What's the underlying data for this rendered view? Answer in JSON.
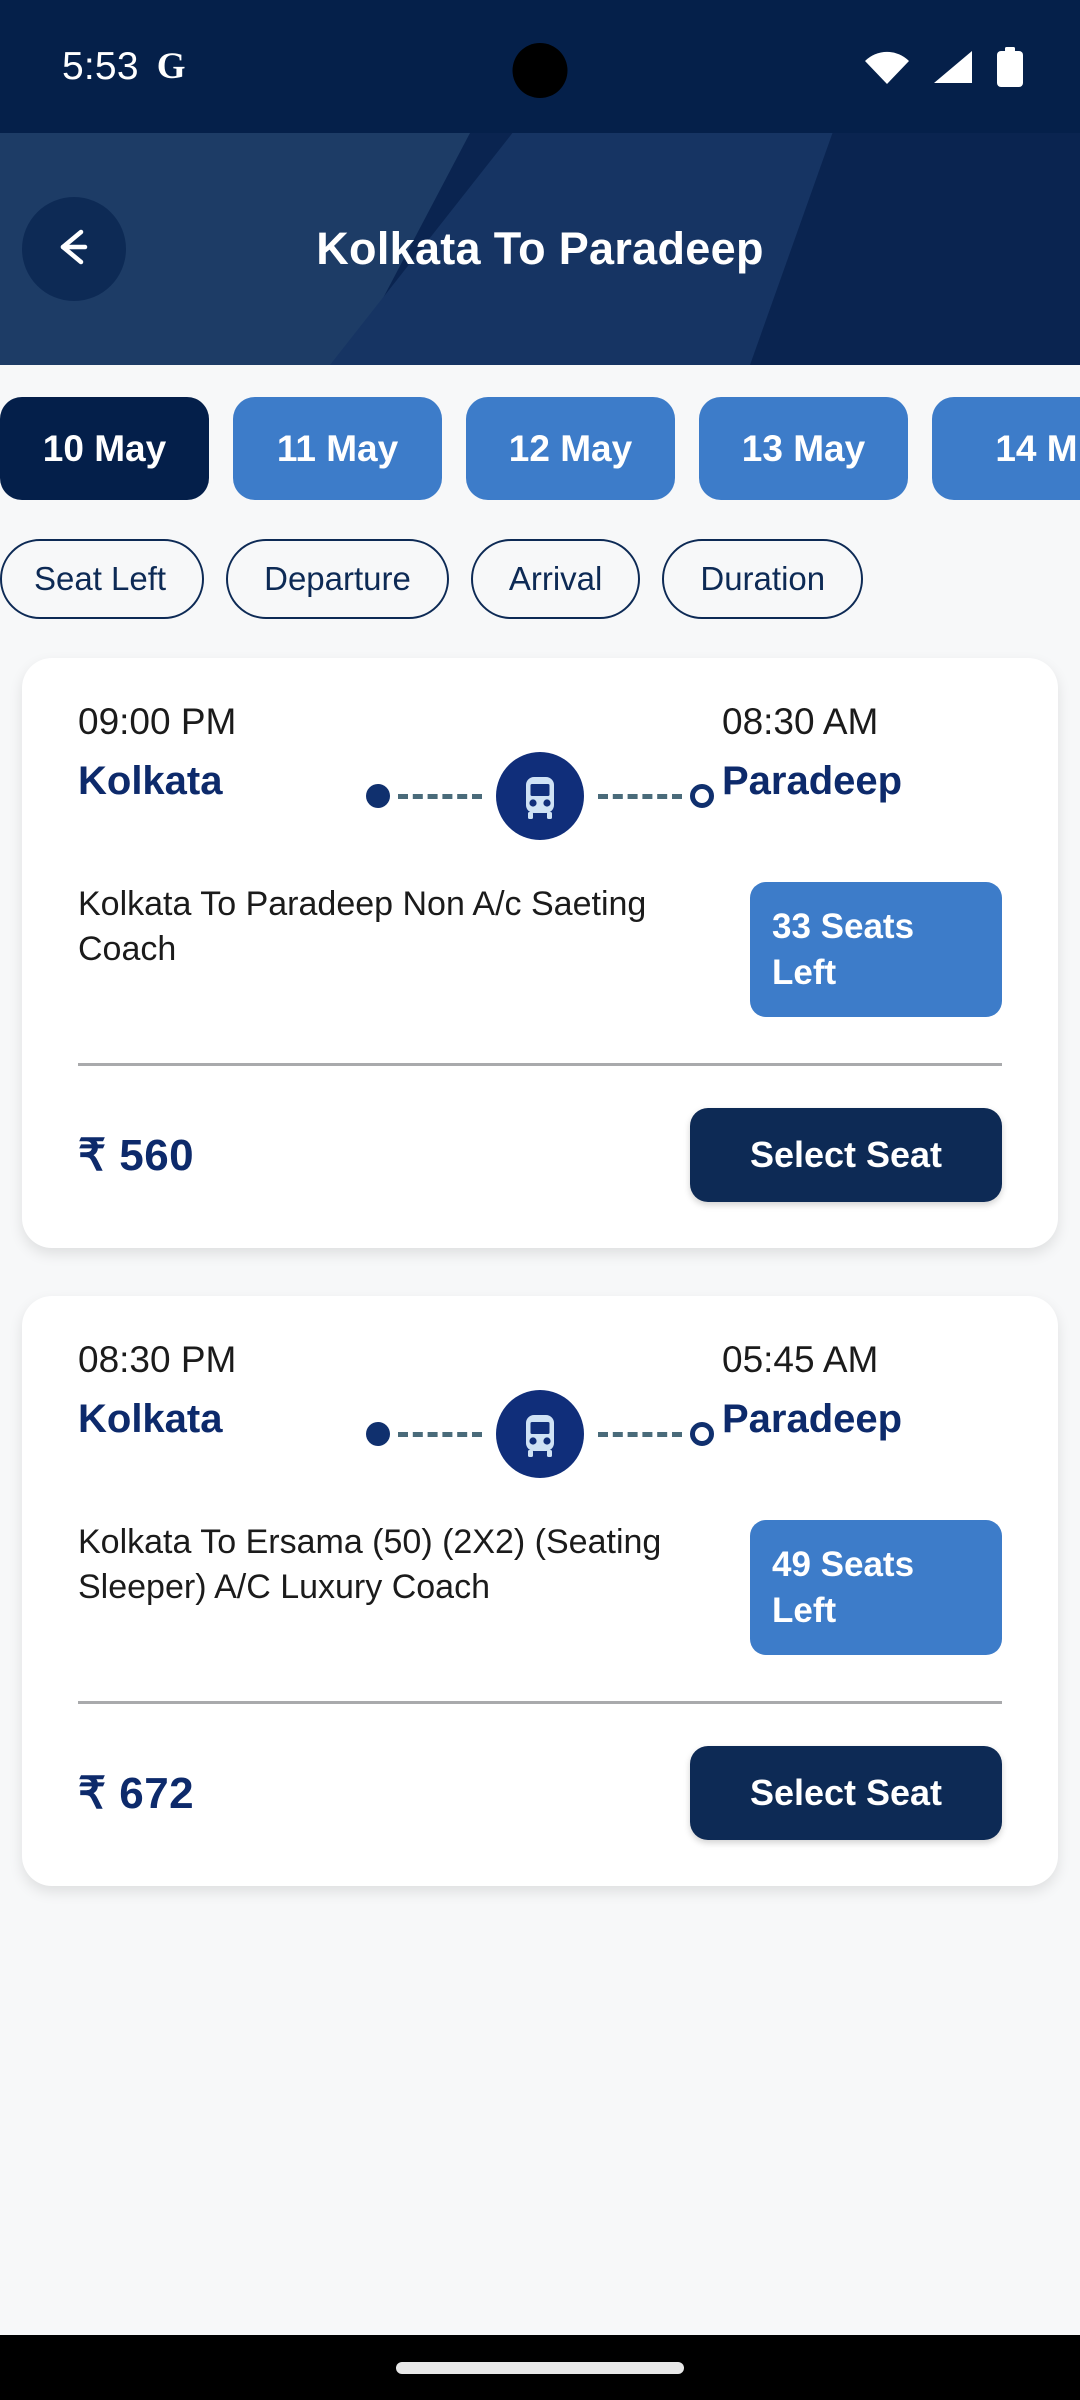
{
  "status_bar": {
    "time": "5:53",
    "app_glyph": "G",
    "icons": [
      "wifi-icon",
      "cellular-signal-icon",
      "battery-icon"
    ]
  },
  "header": {
    "title": "Kolkata To Paradeep",
    "back_icon": "arrow-left-icon"
  },
  "date_filter": {
    "selected_index": 0,
    "chips": [
      {
        "label": "10 May",
        "selected": true
      },
      {
        "label": "11 May",
        "selected": false
      },
      {
        "label": "12 May",
        "selected": false
      },
      {
        "label": "13 May",
        "selected": false
      },
      {
        "label": "14 M",
        "selected": false
      }
    ]
  },
  "sort_filters": [
    {
      "label": "Seat Left"
    },
    {
      "label": "Departure"
    },
    {
      "label": "Arrival"
    },
    {
      "label": "Duration"
    }
  ],
  "buses": [
    {
      "departure_time": "09:00 PM",
      "origin": "Kolkata",
      "arrival_time": "08:30 AM",
      "destination": "Paradeep",
      "bus_name": "Kolkata To Paradeep Non A/c Saeting Coach",
      "seats_left": "33 Seats Left",
      "price": "₹ 560",
      "cta": "Select Seat",
      "bus_icon": "bus-icon"
    },
    {
      "departure_time": "08:30 PM",
      "origin": "Kolkata",
      "arrival_time": "05:45 AM",
      "destination": "Paradeep",
      "bus_name": "Kolkata To Ersama (50) (2X2) (Seating Sleeper) A/C Luxury Coach",
      "seats_left": "49 Seats Left",
      "price": "₹ 672",
      "cta": "Select Seat",
      "bus_icon": "bus-icon"
    }
  ],
  "colors": {
    "status_bar_bg": "#05204a",
    "header_dark": "#0a2450",
    "header_mid": "#163463",
    "header_light": "#1d3c66",
    "accent_blue": "#3d7cc9",
    "navy": "#0d2a55",
    "city_text": "#0d2a6b",
    "page_bg": "#f7f8f9",
    "card_bg": "#ffffff",
    "divider": "#a9aaac",
    "nav_bar_bg": "#000000"
  }
}
